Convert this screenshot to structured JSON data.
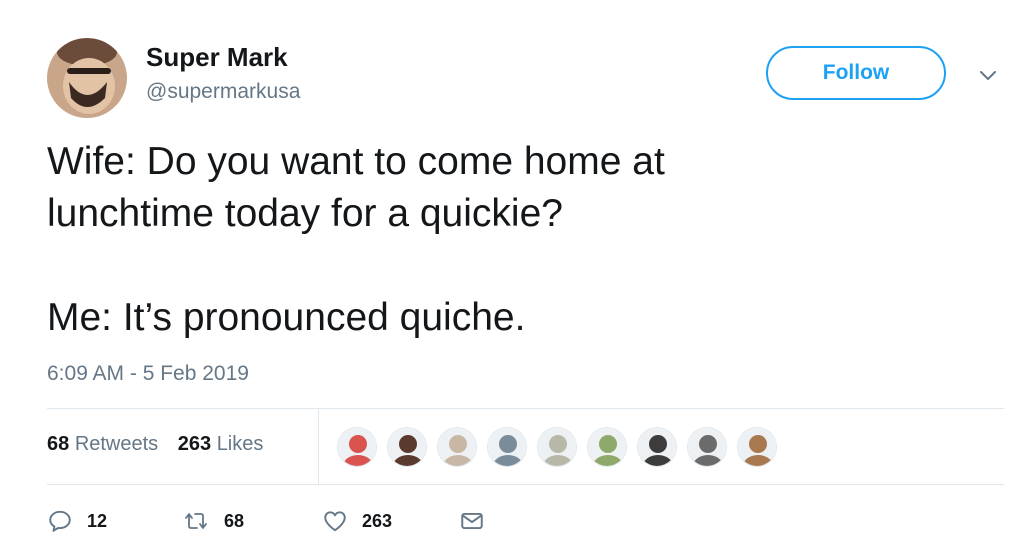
{
  "author": {
    "display_name": "Super Mark",
    "handle": "@supermarkusa",
    "avatar_icon": "user-avatar-photo"
  },
  "header": {
    "follow_label": "Follow",
    "menu_icon": "chevron-down-icon",
    "accent_color": "#1da1f2"
  },
  "tweet": {
    "line1": "Wife: Do you want to come home at",
    "line2": "lunchtime today for a quickie?",
    "line3": "Me: It’s pronounced quiche."
  },
  "timestamp": "6:09 AM - 5 Feb 2019",
  "stats": {
    "retweets_count": "68",
    "retweets_label": "Retweets",
    "likes_count": "263",
    "likes_label": "Likes"
  },
  "likers": [
    {
      "name": "liker-avatar-1",
      "color": "#d9534f"
    },
    {
      "name": "liker-avatar-2",
      "color": "#5a3a2e"
    },
    {
      "name": "liker-avatar-3",
      "color": "#c9b7a6"
    },
    {
      "name": "liker-avatar-4",
      "color": "#7a8b9a"
    },
    {
      "name": "liker-avatar-5",
      "color": "#b8b8a8"
    },
    {
      "name": "liker-avatar-6",
      "color": "#8fa86b"
    },
    {
      "name": "liker-avatar-7",
      "color": "#3c3c3c"
    },
    {
      "name": "liker-avatar-8",
      "color": "#6b6b6b"
    },
    {
      "name": "liker-avatar-9",
      "color": "#a8794f"
    }
  ],
  "actions": {
    "reply_count": "12",
    "retweet_count": "68",
    "like_count": "263"
  },
  "colors": {
    "text_primary": "#14171a",
    "text_secondary": "#657786",
    "divider": "#e1e8ed"
  }
}
